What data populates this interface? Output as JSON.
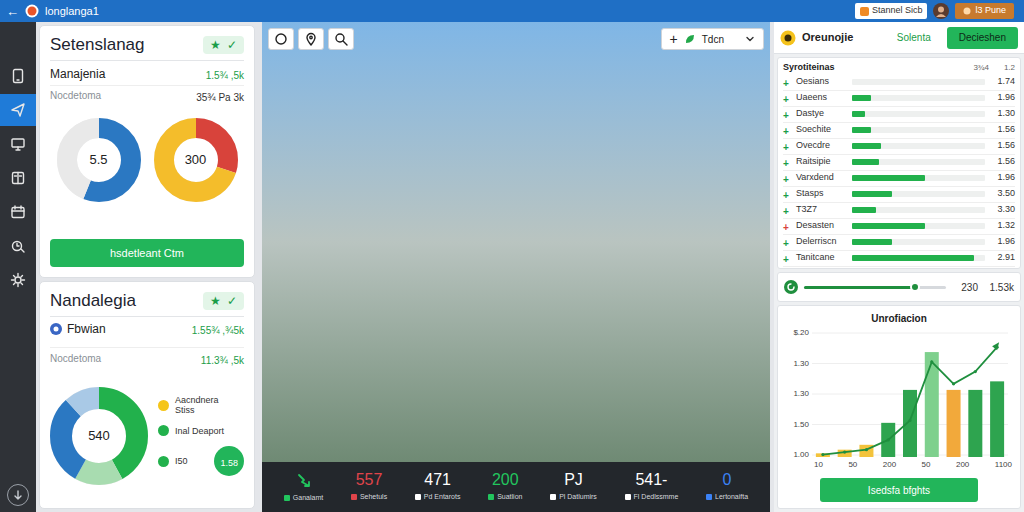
{
  "topbar": {
    "back": "←",
    "title": "longlanga1",
    "search_button": "Stannel Sicb",
    "user_button": "l3 Pune"
  },
  "sidebar": {
    "items": [
      {
        "selected": false
      },
      {
        "selected": true
      },
      {
        "selected": false
      },
      {
        "selected": false
      },
      {
        "selected": false
      },
      {
        "selected": false
      },
      {
        "selected": false
      }
    ]
  },
  "summary_card": {
    "title": "Setenslanag",
    "badge": [
      "★",
      "✓"
    ],
    "rows": [
      {
        "label": "Manajenia",
        "value": "1.5¾ ,5k",
        "color": "#1a9d48"
      },
      {
        "label": "Nocdetoma",
        "value": "35¾ Pa 3k",
        "color": "#333333"
      }
    ],
    "donuts": [
      {
        "center": "5.5",
        "segments": [
          {
            "level": 0.56,
            "color": "#2b78c2"
          },
          {
            "level": 0.44,
            "color": "#e9e9e9"
          }
        ]
      },
      {
        "center": "300",
        "segments": [
          {
            "level": 0.3,
            "color": "#d8433b"
          },
          {
            "level": 0.7,
            "color": "#f4bd2b"
          }
        ]
      }
    ],
    "button": "hsdetleant Ctm"
  },
  "detail_card": {
    "title": "Nandalegia",
    "badge": [
      "★",
      "✓"
    ],
    "rows": [
      {
        "label": "Fbwian",
        "value": "1.55¾ ,¾5k",
        "color": "#1a9d48"
      },
      {
        "label": "Nocdetoma",
        "value": "11.3¾ ,5k",
        "color": "#1a9d48"
      }
    ],
    "donut": {
      "center": "540",
      "segments": [
        {
          "level": 0.42,
          "color": "#22b14c"
        },
        {
          "level": 0.16,
          "color": "#a8dcb0"
        },
        {
          "level": 0.3,
          "color": "#2b78c2"
        },
        {
          "level": 0.12,
          "color": "#a9c9e6"
        }
      ]
    },
    "legend": [
      {
        "label": "Aacndnera Stiss",
        "color": "#f5c518"
      },
      {
        "label": "Inal Deaport",
        "color": "#22b14c"
      },
      {
        "label": "I50",
        "color": "#22b14c"
      }
    ],
    "badge_value": "1.58"
  },
  "map": {
    "toolbar": {
      "add": "+",
      "label": "Tdcn"
    },
    "stats": [
      {
        "kind": "icon",
        "label": "Ganalamt",
        "color": "#22c55e"
      },
      {
        "kind": "value",
        "value": "557",
        "label": "Sehetuls",
        "color": "#e0444a"
      },
      {
        "kind": "value",
        "value": "471",
        "label": "Pd Entarots",
        "color": "#ffffff"
      },
      {
        "kind": "value",
        "value": "200",
        "label": "Suatlion",
        "color": "#22c55e"
      },
      {
        "kind": "value",
        "value": "PJ",
        "label": "Pl Datlumirs",
        "color": "#ffffff"
      },
      {
        "kind": "value",
        "value": "541-",
        "label": "Fl Dedlssmme",
        "color": "#ffffff"
      },
      {
        "kind": "value",
        "value": "0",
        "label": "Lertonaifta",
        "color": "#3b82f6"
      }
    ]
  },
  "right": {
    "header": {
      "title": "Oreunojie",
      "link": "Solenta",
      "button": "Decieshen"
    },
    "list": {
      "title": "Syrotiteinas",
      "col1": "3¾4",
      "col2": "1.2",
      "rows": [
        {
          "marker": "+",
          "color": "#1a9d48",
          "name": "Oesians",
          "level": 0.0,
          "value": "1.74"
        },
        {
          "marker": "+",
          "color": "#1a9d48",
          "name": "Uaeens",
          "level": 0.14,
          "value": "1.96"
        },
        {
          "marker": "+",
          "color": "#1a9d48",
          "name": "Dastye",
          "level": 0.1,
          "value": "1.30"
        },
        {
          "marker": "+",
          "color": "#1a9d48",
          "name": "Soechite",
          "level": 0.14,
          "value": "1.56"
        },
        {
          "marker": "+",
          "color": "#1a9d48",
          "name": "Ovecdre",
          "level": 0.22,
          "value": "1.56"
        },
        {
          "marker": "+",
          "color": "#1a9d48",
          "name": "Raitsipie",
          "level": 0.2,
          "value": "1.56"
        },
        {
          "marker": "+",
          "color": "#1a9d48",
          "name": "Varxdend",
          "level": 0.55,
          "value": "1.96"
        },
        {
          "marker": "+",
          "color": "#1a9d48",
          "name": "Stasps",
          "level": 0.3,
          "value": "3.50"
        },
        {
          "marker": "+",
          "color": "#1a9d48",
          "name": "T3Z7",
          "level": 0.18,
          "value": "3.30"
        },
        {
          "marker": "+",
          "color": "#d8433b",
          "name": "Desasten",
          "level": 0.55,
          "value": "1.32"
        },
        {
          "marker": "+",
          "color": "#1a9d48",
          "name": "Delerriscn",
          "level": 0.3,
          "value": "1.96"
        },
        {
          "marker": "+",
          "color": "#1a9d48",
          "name": "Tanitcane",
          "level": 0.92,
          "value": "2.91"
        }
      ]
    },
    "slider": {
      "level": 0.78,
      "value": "230",
      "max": "1.53k"
    },
    "chart": {
      "title": "Unrofiacion",
      "y_ticks": [
        "$.20",
        "1.30",
        "1.30",
        "1.50",
        "1.00"
      ],
      "x_ticks": [
        "10",
        "50",
        "200",
        "50",
        "200",
        "1100"
      ],
      "bars": [
        {
          "value": 3,
          "color": "#f3c33c"
        },
        {
          "value": 6,
          "color": "#f3c33c"
        },
        {
          "value": 10,
          "color": "#f3c33c"
        },
        {
          "value": 28,
          "color": "#2ea44f"
        },
        {
          "value": 55,
          "color": "#2ea44f"
        },
        {
          "value": 86,
          "color": "#7ed08d"
        },
        {
          "value": 55,
          "color": "#f2a93b"
        },
        {
          "value": 55,
          "color": "#2ea44f"
        },
        {
          "value": 62,
          "color": "#2ea44f"
        }
      ],
      "line": {
        "values": [
          2,
          4,
          6,
          14,
          30,
          78,
          60,
          70,
          90
        ],
        "color": "#1f8f3e"
      }
    },
    "chart_button": "Isedsfa bfghts"
  }
}
